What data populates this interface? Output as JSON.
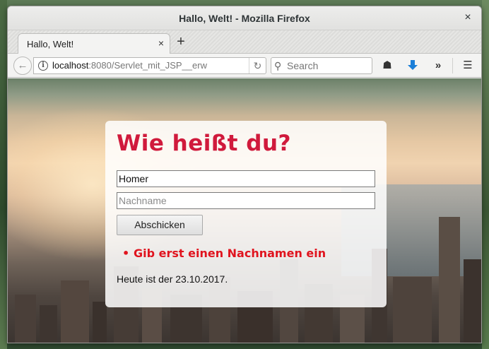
{
  "window": {
    "title": "Hallo, Welt! - Mozilla Firefox",
    "close_glyph": "×"
  },
  "tabs": [
    {
      "label": "Hallo, Welt!",
      "close_glyph": "×",
      "active": true
    }
  ],
  "newtab_glyph": "+",
  "navbar": {
    "back_glyph": "←",
    "info_glyph": "i",
    "url_host": "localhost",
    "url_rest": ":8080/Servlet_mit_JSP__erw",
    "reload_glyph": "↻",
    "search_placeholder": "Search",
    "search_icon_glyph": "⚲",
    "icons": {
      "account": "account-icon",
      "download": "download-icon",
      "overflow": "overflow-chevron-icon",
      "menu": "hamburger-menu-icon"
    },
    "download_glyph": "🡇",
    "overflow_glyph": "»",
    "menu_glyph": "☰",
    "account_glyph": "☗"
  },
  "page": {
    "heading": "Wie heißt du?",
    "first_name_value": "Homer",
    "last_name_placeholder": "Nachname",
    "submit_label": "Abschicken",
    "error_bullet": "•",
    "error_message": "Gib erst einen Nachnamen ein",
    "date_text": "Heute ist der 23.10.2017.",
    "heading_color": "#d01a3c",
    "error_color": "#e0141e"
  }
}
